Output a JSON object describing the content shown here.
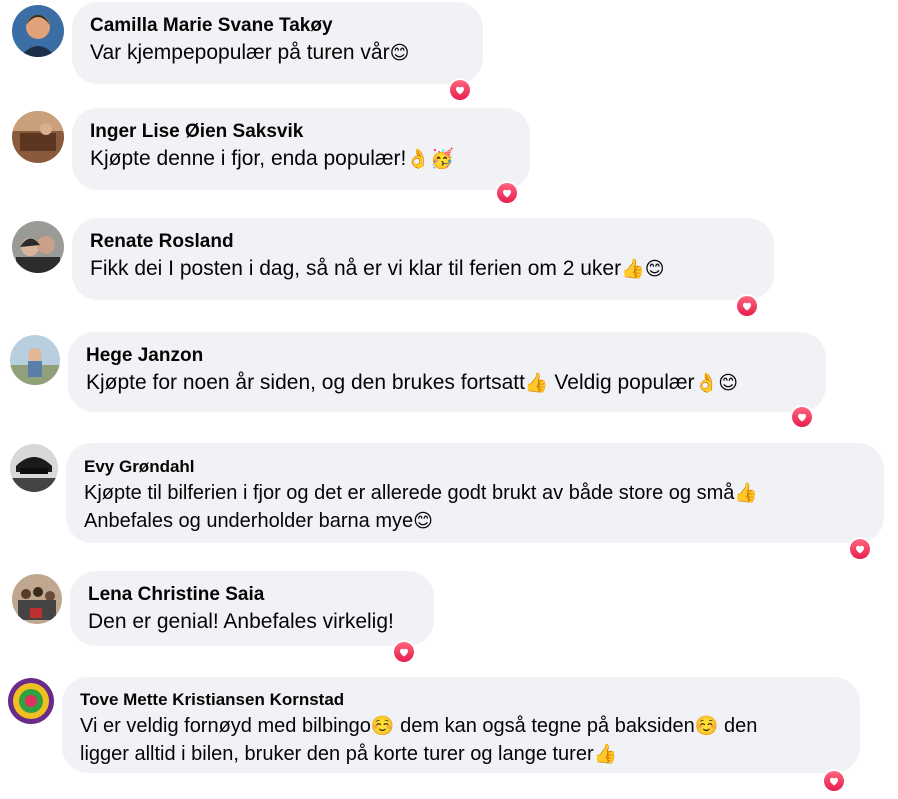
{
  "comments": [
    {
      "author": "Camilla Marie Svane Takøy",
      "text": "Var kjempepopulær på turen vår",
      "emoji": "😊",
      "reaction_icon": "heart-reaction-icon"
    },
    {
      "author": "Inger Lise Øien Saksvik",
      "text": "Kjøpte denne i fjor, enda populær!",
      "emoji": "👌🥳",
      "reaction_icon": "heart-reaction-icon"
    },
    {
      "author": "Renate Rosland",
      "text": "Fikk dei I posten i dag, så nå er vi klar til ferien om 2 uker",
      "emoji": "👍😊",
      "reaction_icon": "heart-reaction-icon"
    },
    {
      "author": "Hege Janzon",
      "text_a": "Kjøpte for noen år siden, og den brukes fortsatt",
      "emoji_a": "👍",
      "text_b": " Veldig populær",
      "emoji_b": "👌😊",
      "reaction_icon": "heart-reaction-icon"
    },
    {
      "author": "Evy Grøndahl",
      "line1": "Kjøpte til bilferien i fjor og det er allerede godt brukt av både store og små",
      "emoji1": "👍",
      "line2": "Anbefales og underholder barna mye",
      "emoji2": "😊",
      "reaction_icon": "heart-reaction-icon"
    },
    {
      "author": "Lena Christine Saia",
      "text": "Den er genial! Anbefales virkelig!",
      "reaction_icon": "heart-reaction-icon"
    },
    {
      "author": "Tove Mette Kristiansen Kornstad",
      "seg1": "Vi er veldig fornøyd med bilbingo",
      "emo1": "☺️",
      "seg2": " dem kan også tegne på baksiden",
      "emo2": "☺️",
      "seg3": " den",
      "line2": "ligger alltid i bilen, bruker den på korte turer og lange turer",
      "emo3": "👍",
      "reaction_icon": "heart-reaction-icon"
    }
  ],
  "colors": {
    "bubble": "#f0f2f5",
    "heart": "#e61e4d",
    "text": "#050505"
  }
}
